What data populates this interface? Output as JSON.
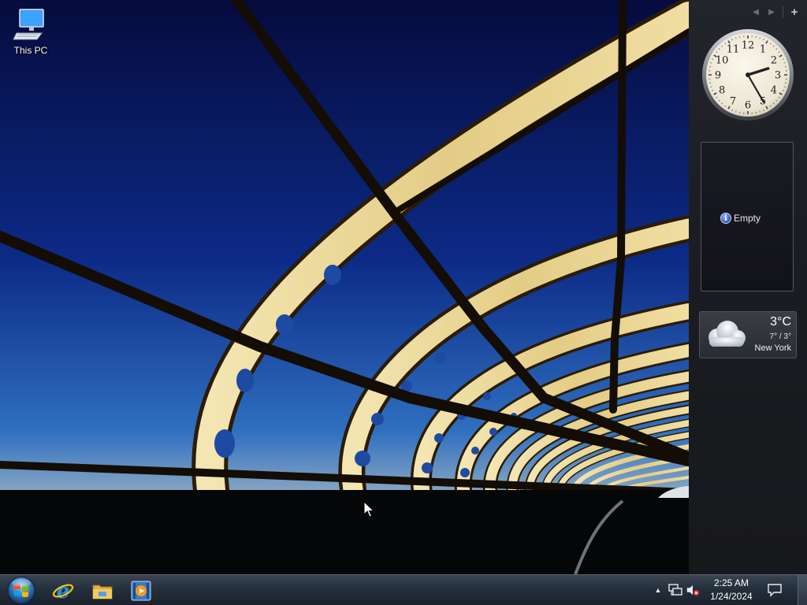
{
  "desktop": {
    "icons": [
      {
        "label": "This PC",
        "icon": "computer-monitor-icon"
      }
    ]
  },
  "sidebar": {
    "nav": {
      "prev_icon": "arrow-left-icon",
      "next_icon": "arrow-right-icon",
      "add_icon": "plus-icon"
    },
    "clock": {
      "hour": 2,
      "minute": 25,
      "numerals": [
        "12",
        "1",
        "2",
        "3",
        "4",
        "5",
        "6",
        "7",
        "8",
        "9",
        "10",
        "11"
      ]
    },
    "feed": {
      "message": "Empty",
      "icon": "info-icon"
    },
    "weather": {
      "temperature": "3°C",
      "range": "7° / 3°",
      "city": "New York",
      "icon": "cloudy-icon"
    }
  },
  "taskbar": {
    "start_icon": "windows-start-orb-icon",
    "pinned": [
      {
        "name": "internet-explorer",
        "icon": "internet-explorer-icon"
      },
      {
        "name": "file-explorer",
        "icon": "folder-icon"
      },
      {
        "name": "media-player",
        "icon": "media-player-icon"
      }
    ],
    "tray": {
      "overflow_icon": "chevron-up-icon",
      "network_icon": "network-icon",
      "volume_icon": "volume-muted-icon",
      "time": "2:25 AM",
      "date": "1/24/2024",
      "notification_icon": "action-center-icon"
    }
  },
  "colors": {
    "sky_top": "#0a0f4a",
    "sky_bottom": "#2a65b8",
    "bridge": "#e9d79a",
    "taskbar": "#25303d",
    "sidebar": "#1b1d22"
  }
}
